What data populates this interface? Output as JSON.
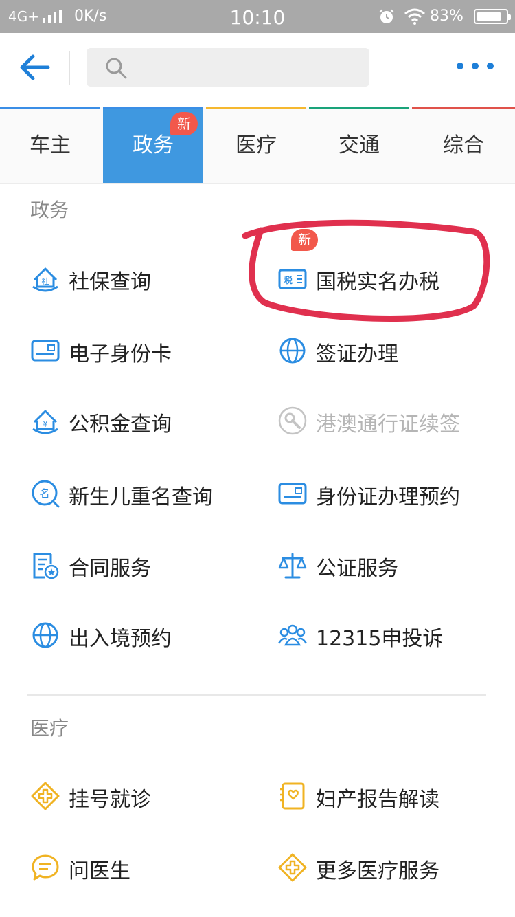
{
  "status_bar": {
    "network": "4G+",
    "speed": "0K/s",
    "time": "10:10",
    "battery": "83%"
  },
  "header": {
    "search_placeholder": ""
  },
  "tabs": [
    {
      "label": "车主",
      "color": "#3a8ee6"
    },
    {
      "label": "政务",
      "color": "#3a8ee6",
      "badge": "新"
    },
    {
      "label": "医疗",
      "color": "#f5b830"
    },
    {
      "label": "交通",
      "color": "#1aa37a"
    },
    {
      "label": "综合",
      "color": "#e0524a"
    }
  ],
  "sections": {
    "gov": {
      "title": "政务",
      "items": [
        {
          "label": "社保查询",
          "icon": "social-security-icon"
        },
        {
          "label": "国税实名办税",
          "icon": "tax-icon",
          "badge": "新"
        },
        {
          "label": "电子身份卡",
          "icon": "id-card-icon"
        },
        {
          "label": "签证办理",
          "icon": "globe-icon"
        },
        {
          "label": "公积金查询",
          "icon": "housing-fund-icon"
        },
        {
          "label": "港澳通行证续签",
          "icon": "wrench-icon"
        },
        {
          "label": "新生儿重名查询",
          "icon": "name-search-icon"
        },
        {
          "label": "身份证办理预约",
          "icon": "id-card-icon"
        },
        {
          "label": "合同服务",
          "icon": "contract-icon"
        },
        {
          "label": "公证服务",
          "icon": "scales-icon"
        },
        {
          "label": "出入境预约",
          "icon": "globe-icon"
        },
        {
          "label": "12315申投诉",
          "icon": "people-icon"
        }
      ]
    },
    "medical": {
      "title": "医疗",
      "items": [
        {
          "label": "挂号就诊",
          "icon": "medical-cross-icon"
        },
        {
          "label": "妇产报告解读",
          "icon": "report-heart-icon"
        },
        {
          "label": "问医生",
          "icon": "chat-bubble-icon"
        },
        {
          "label": "更多医疗服务",
          "icon": "medical-cross-icon"
        }
      ]
    }
  },
  "colors": {
    "blue": "#3a8ee6",
    "yellow": "#f0b323",
    "badge": "#f2584b",
    "annotation": "#e0304e"
  }
}
